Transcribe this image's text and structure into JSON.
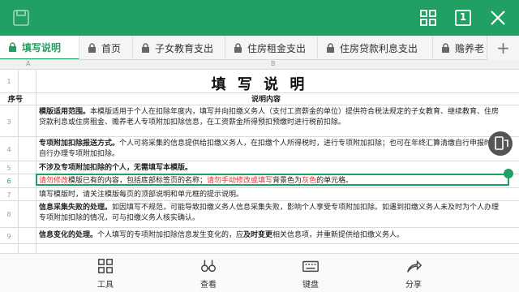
{
  "toolbar": {
    "icons": [
      "save-icon",
      "grid-icon",
      "page-count-icon",
      "close-icon"
    ],
    "page_count": "1"
  },
  "tabs": [
    {
      "label": "填写说明",
      "active": true,
      "icon": "lock-icon"
    },
    {
      "label": "首页",
      "icon": "lock-icon"
    },
    {
      "label": "子女教育支出",
      "icon": "lock-icon"
    },
    {
      "label": "住房租金支出",
      "icon": "lock-icon"
    },
    {
      "label": "住房贷款利息支出",
      "icon": "lock-icon"
    },
    {
      "label": "赡养老",
      "icon": "lock-icon"
    }
  ],
  "add_tab_label": "+",
  "sheet": {
    "col_a": "A",
    "col_b": "B",
    "title": "填 写 说 明",
    "row_numbers": [
      "1",
      "2",
      "3",
      "4",
      "5",
      "6",
      "7",
      "8",
      "9"
    ],
    "header_seq": "序号",
    "header_content": "说明内容",
    "rows": {
      "r1_bold": "模版适用范围。",
      "r1_text": "本模版适用于个人在扣除年度内，填写并向扣缴义务人（支付工资薪金的单位）提供符合税法规定的子女教育、继续教育、住房贷款利息或住房租金、赡养老人专项附加扣除信息，在工资薪金所得预扣预缴时进行税前扣除。",
      "r2_bold": "专项附加扣除报送方式。",
      "r2_text": "个人可将采集的信息提供给扣缴义务人，在扣缴个人所得税时，进行专项附加扣除；也可在年终汇算清缴自行申报时，自行办理专项附加扣除。",
      "r3_bold": "不涉及专项附加扣除的个人，无需填写本模版。",
      "r4_red1": "请勿修改",
      "r4_text1": "模版已有的内容，包括底部标签页的名称；",
      "r4_red2": "请勿手动修改或填写",
      "r4_text2": "背景色为",
      "r4_red3": "灰色",
      "r4_text3": "的单元格。",
      "r5_text": "填写模版时，请关注模版每页的顶部说明和单元框的提示说明。",
      "r6_bold": "信息采集失败的处理。",
      "r6_text": "如因填写不规范，可能导致扣缴义务人信息采集失败，影响个人享受专项附加扣除。如遇到扣缴义务人未及时为个人办理专项附加扣除的情况，可与扣缴义务人核实确认。",
      "r7_bold": "信息变化的处理。",
      "r7_text1": "个人填写的专项附加扣除信息发生变化的，应",
      "r7_bold2": "及时变更",
      "r7_text2": "相关信息项，并重新提供给扣缴义务人。"
    }
  },
  "bottom": {
    "tools": "工具",
    "view": "查看",
    "keyboard": "键盘",
    "share": "分享"
  },
  "colors": {
    "brand": "#21a064",
    "red_text": "#e0312c"
  }
}
